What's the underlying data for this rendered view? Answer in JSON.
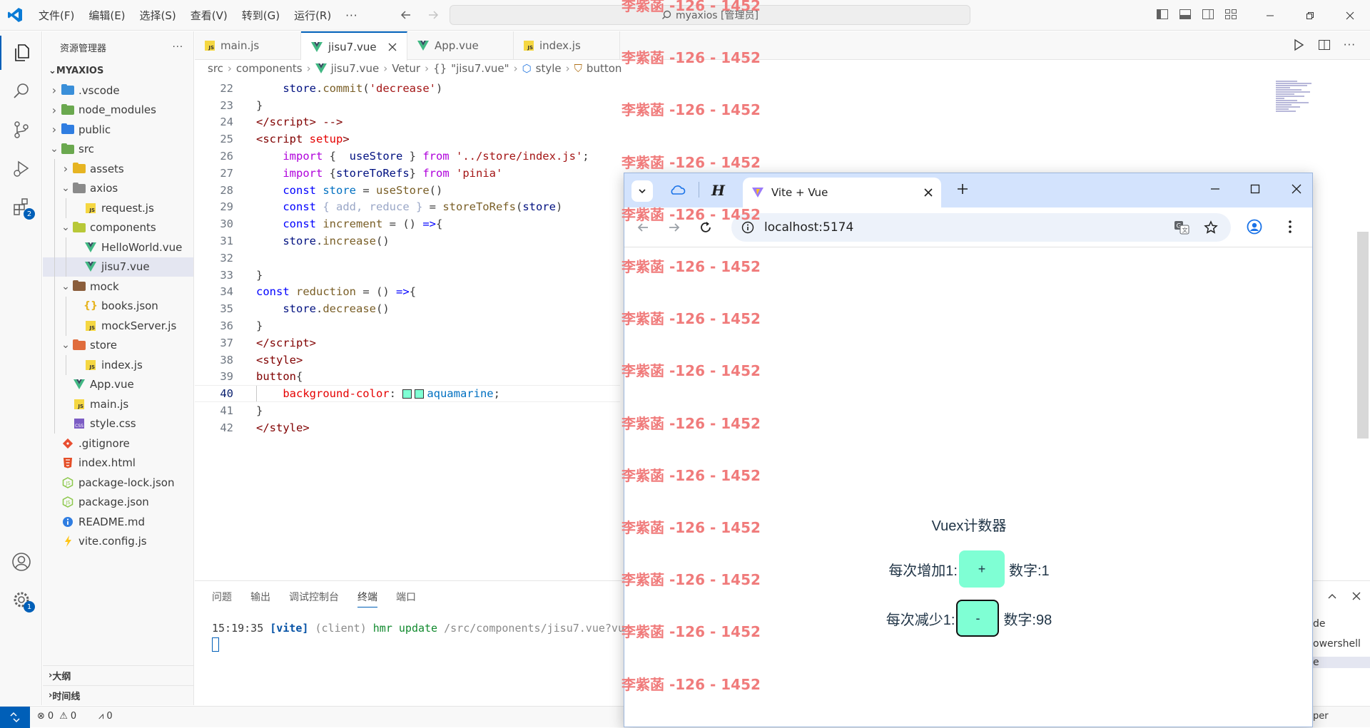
{
  "titlebar": {
    "menu": [
      "文件(F)",
      "编辑(E)",
      "选择(S)",
      "查看(V)",
      "转到(G)",
      "运行(R)",
      "···"
    ],
    "command_center": "myaxios [管理员]"
  },
  "activity": {
    "extensions_badge": "2",
    "settings_badge": "1"
  },
  "sidebar": {
    "title": "资源管理器",
    "root": "MYAXIOS",
    "tree": [
      {
        "label": ".vscode",
        "depth": 1,
        "kind": "folder",
        "expanded": false,
        "color": "#3a8fd9"
      },
      {
        "label": "node_modules",
        "depth": 1,
        "kind": "folder",
        "expanded": false,
        "color": "#6aa84f"
      },
      {
        "label": "public",
        "depth": 1,
        "kind": "folder",
        "expanded": false,
        "color": "#2f7de1"
      },
      {
        "label": "src",
        "depth": 1,
        "kind": "folder",
        "expanded": true,
        "color": "#6aa84f"
      },
      {
        "label": "assets",
        "depth": 2,
        "kind": "folder",
        "expanded": false,
        "color": "#e6b422"
      },
      {
        "label": "axios",
        "depth": 2,
        "kind": "folder",
        "expanded": true,
        "color": "#8a8a8a"
      },
      {
        "label": "request.js",
        "depth": 3,
        "kind": "js"
      },
      {
        "label": "components",
        "depth": 2,
        "kind": "folder",
        "expanded": true,
        "color": "#b8c838"
      },
      {
        "label": "HelloWorld.vue",
        "depth": 3,
        "kind": "vue"
      },
      {
        "label": "jisu7.vue",
        "depth": 3,
        "kind": "vue",
        "selected": true
      },
      {
        "label": "mock",
        "depth": 2,
        "kind": "folder",
        "expanded": true,
        "color": "#8b5e3c"
      },
      {
        "label": "books.json",
        "depth": 3,
        "kind": "json"
      },
      {
        "label": "mockServer.js",
        "depth": 3,
        "kind": "js"
      },
      {
        "label": "store",
        "depth": 2,
        "kind": "folder",
        "expanded": true,
        "color": "#e06c3c"
      },
      {
        "label": "index.js",
        "depth": 3,
        "kind": "js"
      },
      {
        "label": "App.vue",
        "depth": 2,
        "kind": "vue"
      },
      {
        "label": "main.js",
        "depth": 2,
        "kind": "js"
      },
      {
        "label": "style.css",
        "depth": 2,
        "kind": "css"
      },
      {
        "label": ".gitignore",
        "depth": 1,
        "kind": "git"
      },
      {
        "label": "index.html",
        "depth": 1,
        "kind": "html"
      },
      {
        "label": "package-lock.json",
        "depth": 1,
        "kind": "npm"
      },
      {
        "label": "package.json",
        "depth": 1,
        "kind": "npm"
      },
      {
        "label": "README.md",
        "depth": 1,
        "kind": "info"
      },
      {
        "label": "vite.config.js",
        "depth": 1,
        "kind": "vite"
      }
    ],
    "outline": "大纲",
    "timeline": "时间线"
  },
  "tabs": [
    {
      "label": "main.js",
      "kind": "js"
    },
    {
      "label": "jisu7.vue",
      "kind": "vue",
      "active": true
    },
    {
      "label": "App.vue",
      "kind": "vue"
    },
    {
      "label": "index.js",
      "kind": "js"
    }
  ],
  "breadcrumb": [
    "src",
    "components",
    "jisu7.vue",
    "Vetur",
    "\"jisu7.vue\"",
    "style",
    "button"
  ],
  "code": {
    "current_line": "40",
    "lines": [
      {
        "n": "22",
        "tokens": [
          [
            "    ",
            "p"
          ],
          [
            "store",
            "v"
          ],
          [
            ".",
            "p"
          ],
          [
            "commit",
            "f"
          ],
          [
            "(",
            "p"
          ],
          [
            "'decrease'",
            "s"
          ],
          [
            ")",
            "p"
          ]
        ]
      },
      {
        "n": "23",
        "tokens": [
          [
            "}",
            "p"
          ]
        ]
      },
      {
        "n": "24",
        "tokens": [
          [
            "</",
            "t"
          ],
          [
            "script",
            "t"
          ],
          [
            "> ",
            "t"
          ],
          [
            "-->",
            "t"
          ]
        ]
      },
      {
        "n": "25",
        "tokens": [
          [
            "<",
            "t"
          ],
          [
            "script",
            "t"
          ],
          [
            " setup",
            "attr"
          ],
          [
            ">",
            "t"
          ]
        ]
      },
      {
        "n": "26",
        "tokens": [
          [
            "    ",
            "p"
          ],
          [
            "import",
            "kw"
          ],
          [
            " {  ",
            "p"
          ],
          [
            "useStore",
            "v"
          ],
          [
            " } ",
            "p"
          ],
          [
            "from",
            "kw"
          ],
          [
            " ",
            "p"
          ],
          [
            "'../store/index.js'",
            "s"
          ],
          [
            ";",
            "p"
          ]
        ]
      },
      {
        "n": "27",
        "tokens": [
          [
            "    ",
            "p"
          ],
          [
            "import",
            "kw"
          ],
          [
            " {",
            "p"
          ],
          [
            "storeToRefs",
            "v"
          ],
          [
            "} ",
            "p"
          ],
          [
            "from",
            "kw"
          ],
          [
            " ",
            "p"
          ],
          [
            "'pinia'",
            "s"
          ]
        ]
      },
      {
        "n": "28",
        "tokens": [
          [
            "    ",
            "p"
          ],
          [
            "const",
            "k"
          ],
          [
            " ",
            "p"
          ],
          [
            "store",
            "vg"
          ],
          [
            " = ",
            "p"
          ],
          [
            "useStore",
            "f"
          ],
          [
            "()",
            "p"
          ]
        ]
      },
      {
        "n": "29",
        "tokens": [
          [
            "    ",
            "p"
          ],
          [
            "const",
            "k"
          ],
          [
            " { add, reduce }",
            "dim"
          ],
          [
            " = ",
            "p"
          ],
          [
            "storeToRefs",
            "f"
          ],
          [
            "(",
            "p"
          ],
          [
            "store",
            "v"
          ],
          [
            ")",
            "p"
          ]
        ]
      },
      {
        "n": "30",
        "tokens": [
          [
            "    ",
            "p"
          ],
          [
            "const",
            "k"
          ],
          [
            " ",
            "p"
          ],
          [
            "increment",
            "f"
          ],
          [
            " = ",
            "p"
          ],
          [
            "() ",
            "p"
          ],
          [
            "=>",
            "k"
          ],
          [
            "{",
            "p"
          ]
        ]
      },
      {
        "n": "31",
        "tokens": [
          [
            "    ",
            "p"
          ],
          [
            "store",
            "v"
          ],
          [
            ".",
            "p"
          ],
          [
            "increase",
            "f"
          ],
          [
            "()",
            "p"
          ]
        ]
      },
      {
        "n": "32",
        "tokens": [
          [
            "",
            "p"
          ]
        ]
      },
      {
        "n": "33",
        "tokens": [
          [
            "}",
            "p"
          ]
        ]
      },
      {
        "n": "34",
        "tokens": [
          [
            "const",
            "k"
          ],
          [
            " ",
            "p"
          ],
          [
            "reduction",
            "f"
          ],
          [
            " = ",
            "p"
          ],
          [
            "() ",
            "p"
          ],
          [
            "=>",
            "k"
          ],
          [
            "{",
            "p"
          ]
        ]
      },
      {
        "n": "35",
        "tokens": [
          [
            "    ",
            "p"
          ],
          [
            "store",
            "v"
          ],
          [
            ".",
            "p"
          ],
          [
            "decrease",
            "f"
          ],
          [
            "()",
            "p"
          ]
        ]
      },
      {
        "n": "36",
        "tokens": [
          [
            "}",
            "p"
          ]
        ]
      },
      {
        "n": "37",
        "tokens": [
          [
            "</",
            "t"
          ],
          [
            "script",
            "t"
          ],
          [
            ">",
            "t"
          ]
        ]
      },
      {
        "n": "38",
        "tokens": [
          [
            "<",
            "t"
          ],
          [
            "style",
            "t"
          ],
          [
            ">",
            "t"
          ]
        ]
      },
      {
        "n": "39",
        "tokens": [
          [
            "button",
            "t"
          ],
          [
            "{",
            "p"
          ]
        ]
      },
      {
        "n": "40",
        "tokens": [
          [
            "    ",
            "p"
          ],
          [
            "background-color",
            "attr"
          ],
          [
            ": ",
            "p"
          ],
          [
            "SWATCH",
            "swatch"
          ],
          [
            "aquamarine",
            "vg"
          ],
          [
            ";",
            "p"
          ]
        ]
      },
      {
        "n": "41",
        "tokens": [
          [
            "}",
            "p"
          ]
        ]
      },
      {
        "n": "42",
        "tokens": [
          [
            "</",
            "t"
          ],
          [
            "style",
            "t"
          ],
          [
            ">",
            "t"
          ]
        ]
      }
    ]
  },
  "panel": {
    "tabs": [
      "问题",
      "输出",
      "调试控制台",
      "终端",
      "端口"
    ],
    "active_tab": "终端",
    "terminal_line": "15:19:35 [vite] (client) hmr update /src/components/jisu7.vue?vu",
    "right_items": [
      "de",
      "owershell",
      "e"
    ]
  },
  "statusbar": {
    "errors": "0",
    "warnings": "0",
    "ports": "0",
    "right_text": "per"
  },
  "browser": {
    "tab_title": "Vite + Vue",
    "url": "localhost:5174",
    "counter_title": "Vuex计数器",
    "inc_label": "每次增加1:",
    "inc_button": "+",
    "inc_value": "数字:1",
    "dec_label": "每次减少1:",
    "dec_button": "-",
    "dec_value": "数字:98"
  },
  "watermark": "李紫菡 -126 - 1452",
  "colors": {
    "accent": "#005fb8",
    "button_bg": "#7fffd4",
    "browser_frame": "#d3e3fd"
  }
}
